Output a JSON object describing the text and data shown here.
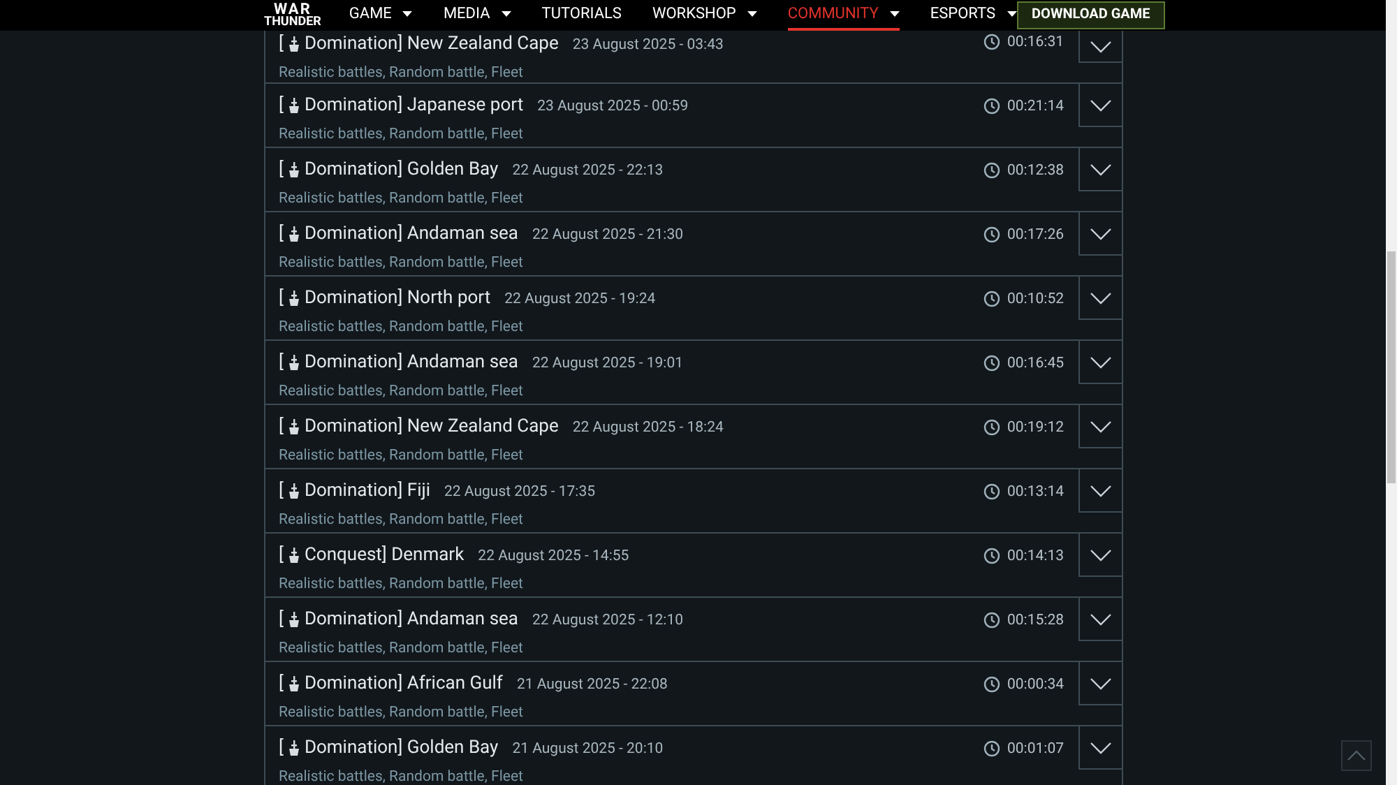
{
  "header": {
    "logo": {
      "top": "WAR",
      "bottom": "THUNDER"
    },
    "nav": [
      {
        "label": "GAME",
        "has_menu": true,
        "selected": false
      },
      {
        "label": "MEDIA",
        "has_menu": true,
        "selected": false
      },
      {
        "label": "TUTORIALS",
        "has_menu": false,
        "selected": false
      },
      {
        "label": "WORKSHOP",
        "has_menu": true,
        "selected": false
      },
      {
        "label": "COMMUNITY",
        "has_menu": true,
        "selected": true
      },
      {
        "label": "ESPORTS",
        "has_menu": true,
        "selected": false
      }
    ],
    "download_button": "DOWNLOAD GAME"
  },
  "battles": [
    {
      "prefix": "[",
      "title": "Domination] New Zealand Cape",
      "date": "23 August 2025 - 03:43",
      "tags": "Realistic battles, Random battle, Fleet",
      "duration": "00:16:31"
    },
    {
      "prefix": "[",
      "title": "Domination] Japanese port",
      "date": "23 August 2025 - 00:59",
      "tags": "Realistic battles, Random battle, Fleet",
      "duration": "00:21:14"
    },
    {
      "prefix": "[",
      "title": "Domination] Golden Bay",
      "date": "22 August 2025 - 22:13",
      "tags": "Realistic battles, Random battle, Fleet",
      "duration": "00:12:38"
    },
    {
      "prefix": "[",
      "title": "Domination] Andaman sea",
      "date": "22 August 2025 - 21:30",
      "tags": "Realistic battles, Random battle, Fleet",
      "duration": "00:17:26"
    },
    {
      "prefix": "[",
      "title": "Domination] North port",
      "date": "22 August 2025 - 19:24",
      "tags": "Realistic battles, Random battle, Fleet",
      "duration": "00:10:52"
    },
    {
      "prefix": "[",
      "title": "Domination] Andaman sea",
      "date": "22 August 2025 - 19:01",
      "tags": "Realistic battles, Random battle, Fleet",
      "duration": "00:16:45"
    },
    {
      "prefix": "[",
      "title": "Domination] New Zealand Cape",
      "date": "22 August 2025 - 18:24",
      "tags": "Realistic battles, Random battle, Fleet",
      "duration": "00:19:12"
    },
    {
      "prefix": "[",
      "title": "Domination] Fiji",
      "date": "22 August 2025 - 17:35",
      "tags": "Realistic battles, Random battle, Fleet",
      "duration": "00:13:14"
    },
    {
      "prefix": "[",
      "title": "Conquest] Denmark",
      "date": "22 August 2025 - 14:55",
      "tags": "Realistic battles, Random battle, Fleet",
      "duration": "00:14:13"
    },
    {
      "prefix": "[",
      "title": "Domination] Andaman sea",
      "date": "22 August 2025 - 12:10",
      "tags": "Realistic battles, Random battle, Fleet",
      "duration": "00:15:28"
    },
    {
      "prefix": "[",
      "title": "Domination] African Gulf",
      "date": "21 August 2025 - 22:08",
      "tags": "Realistic battles, Random battle, Fleet",
      "duration": "00:00:34"
    },
    {
      "prefix": "[",
      "title": "Domination] Golden Bay",
      "date": "21 August 2025 - 20:10",
      "tags": "Realistic battles, Random battle, Fleet",
      "duration": "00:01:07"
    }
  ]
}
